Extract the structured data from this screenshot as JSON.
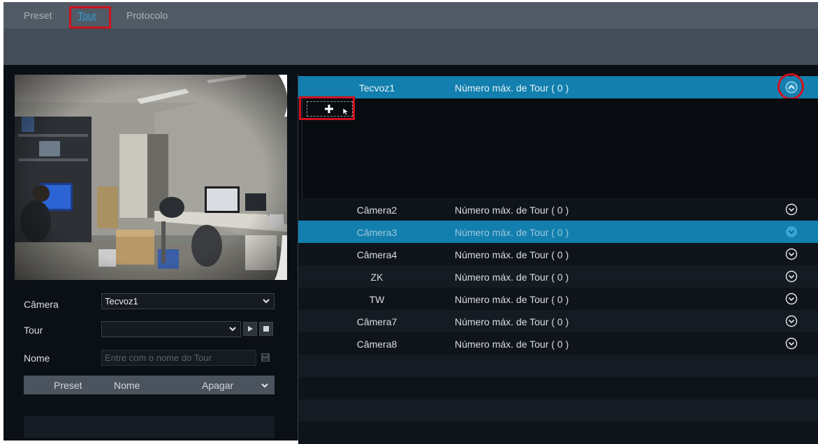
{
  "tabs": [
    {
      "label": "Preset",
      "active": false
    },
    {
      "label": "Tour",
      "active": true
    },
    {
      "label": "Protocolo",
      "active": false
    }
  ],
  "form": {
    "camera_label": "Câmera",
    "camera_value": "Tecvoz1",
    "tour_label": "Tour",
    "tour_value": "",
    "name_label": "Nome",
    "name_placeholder": "Entre com o nome do Tour"
  },
  "preset_table": {
    "headers": [
      "Preset",
      "Nome",
      "Apagar"
    ]
  },
  "cameras": [
    {
      "name": "Tecvoz1",
      "max_tour": "Número máx. de Tour ( 0 )",
      "state": "expanded"
    },
    {
      "name": "Câmera2",
      "max_tour": "Número máx. de Tour ( 0 )",
      "state": "normal"
    },
    {
      "name": "Câmera3",
      "max_tour": "Número máx. de Tour ( 0 )",
      "state": "selected"
    },
    {
      "name": "Câmera4",
      "max_tour": "Número máx. de Tour ( 0 )",
      "state": "normal"
    },
    {
      "name": "ZK",
      "max_tour": "Número máx. de Tour ( 0 )",
      "state": "normal"
    },
    {
      "name": "TW",
      "max_tour": "Número máx. de Tour ( 0 )",
      "state": "normal"
    },
    {
      "name": "Câmera7",
      "max_tour": "Número máx. de Tour ( 0 )",
      "state": "normal"
    },
    {
      "name": "Câmera8",
      "max_tour": "Número máx. de Tour ( 0 )",
      "state": "normal"
    }
  ],
  "colors": {
    "accent": "#127fae",
    "highlight": "#d0121f",
    "tab_active": "#2f9fd8"
  }
}
